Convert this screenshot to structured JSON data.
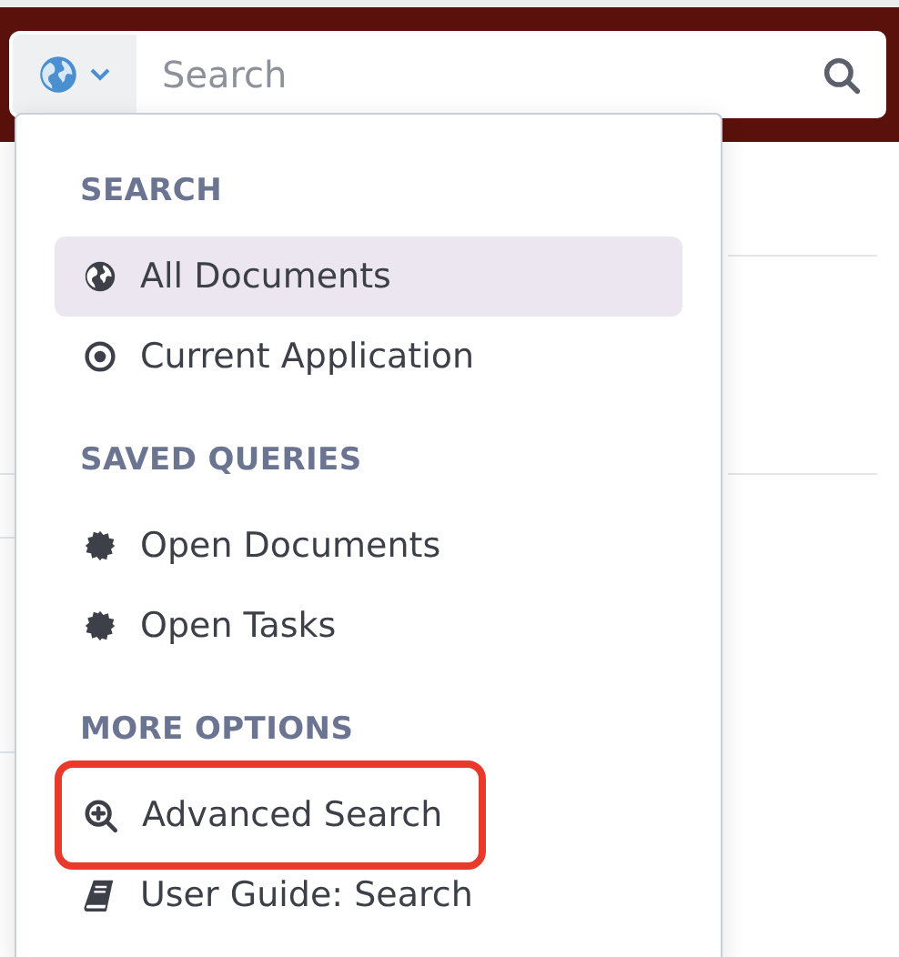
{
  "search_bar": {
    "placeholder": "Search"
  },
  "menu": {
    "sections": [
      {
        "heading": "SEARCH",
        "items": [
          {
            "label": "All Documents",
            "kind": "globe",
            "selected": true,
            "annotated": false
          },
          {
            "label": "Current Application",
            "kind": "target",
            "selected": false,
            "annotated": false
          }
        ]
      },
      {
        "heading": "SAVED QUERIES",
        "items": [
          {
            "label": "Open Documents",
            "kind": "badge",
            "selected": false,
            "annotated": false
          },
          {
            "label": "Open Tasks",
            "kind": "badge",
            "selected": false,
            "annotated": false
          }
        ]
      },
      {
        "heading": "MORE OPTIONS",
        "items": [
          {
            "label": "Advanced Search",
            "kind": "zoom",
            "selected": false,
            "annotated": true
          },
          {
            "label": "User Guide: Search",
            "kind": "book",
            "selected": false,
            "annotated": false
          }
        ]
      }
    ]
  }
}
